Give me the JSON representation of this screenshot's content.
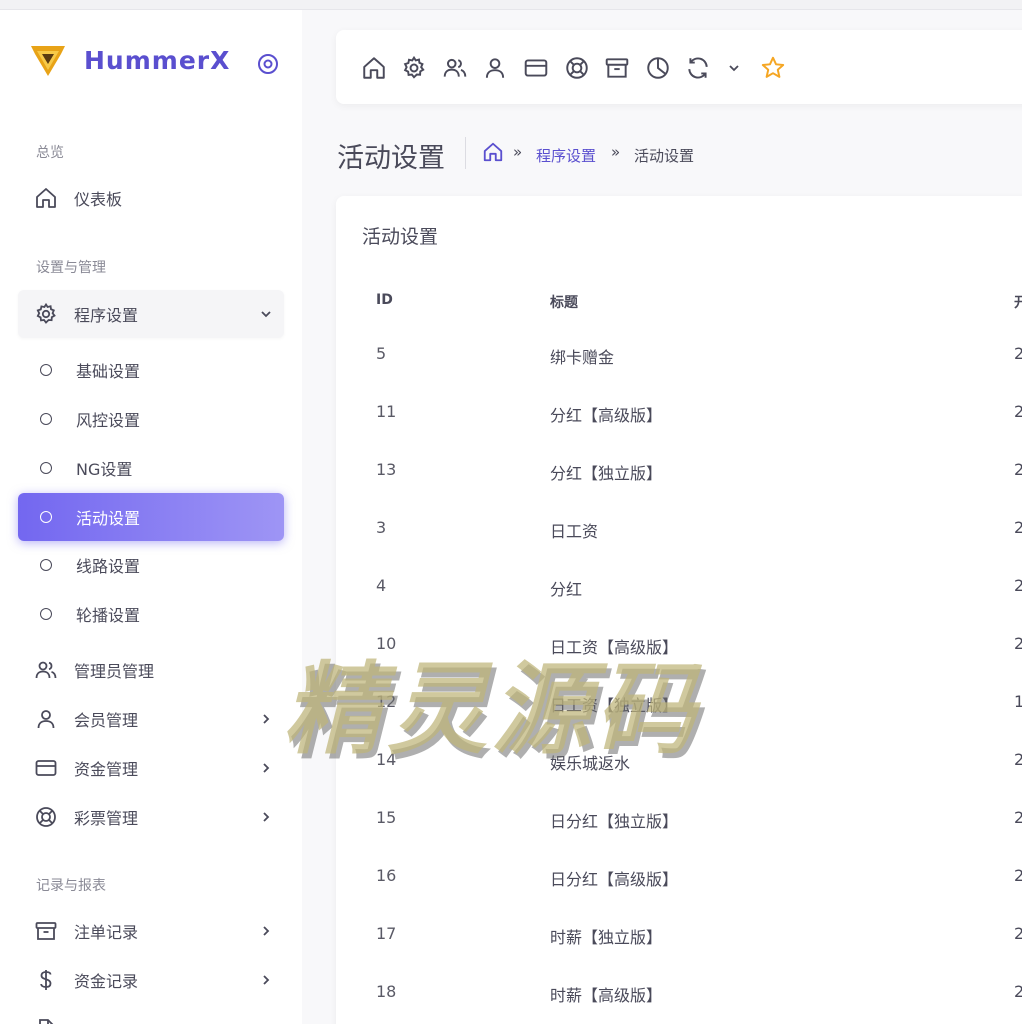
{
  "app": {
    "name": "HummerX"
  },
  "sidebar": {
    "sections": [
      "总览",
      "设置与管理",
      "记录与报表"
    ],
    "items": [
      {
        "label": "仪表板"
      },
      {
        "label": "程序设置"
      },
      {
        "label": "管理员管理"
      },
      {
        "label": "会员管理"
      },
      {
        "label": "资金管理"
      },
      {
        "label": "彩票管理"
      },
      {
        "label": "注单记录"
      },
      {
        "label": "资金记录"
      }
    ],
    "sub_items": [
      {
        "label": "基础设置"
      },
      {
        "label": "风控设置"
      },
      {
        "label": "NG设置"
      },
      {
        "label": "活动设置"
      },
      {
        "label": "线路设置"
      },
      {
        "label": "轮播设置"
      }
    ],
    "active_sub_item": "活动设置"
  },
  "toolbar": {
    "icons": [
      "home-icon",
      "gear-icon",
      "users-icon",
      "user-icon",
      "card-icon",
      "lifebuoy-icon",
      "archive-icon",
      "pie-chart-icon",
      "refresh-icon",
      "chevron-down-icon",
      "star-icon"
    ],
    "star_color": "#f5a623"
  },
  "header": {
    "title": "活动设置",
    "breadcrumb": {
      "separator": "»",
      "parent": "程序设置",
      "current": "活动设置"
    }
  },
  "card": {
    "title": "活动设置",
    "columns": [
      "ID",
      "标题",
      "开"
    ],
    "rows": [
      {
        "id": "5",
        "title": "绑卡赠金",
        "start": "2"
      },
      {
        "id": "11",
        "title": "分红【高级版】",
        "start": "2"
      },
      {
        "id": "13",
        "title": "分红【独立版】",
        "start": "2"
      },
      {
        "id": "3",
        "title": "日工资",
        "start": "2"
      },
      {
        "id": "4",
        "title": "分红",
        "start": "2"
      },
      {
        "id": "10",
        "title": "日工资【高级版】",
        "start": "2"
      },
      {
        "id": "12",
        "title": "日工资【独立版】",
        "start": "1!"
      },
      {
        "id": "14",
        "title": "娱乐城返水",
        "start": "2"
      },
      {
        "id": "15",
        "title": "日分红【独立版】",
        "start": "2"
      },
      {
        "id": "16",
        "title": "日分红【高级版】",
        "start": "2"
      },
      {
        "id": "17",
        "title": "时薪【独立版】",
        "start": "2"
      },
      {
        "id": "18",
        "title": "时薪【高级版】",
        "start": "2"
      }
    ]
  },
  "watermark": {
    "text": "精灵源码"
  },
  "colors": {
    "accent": "#7367f0",
    "brand_text": "#5a4fcf",
    "logo_gold": "#e8a317"
  }
}
